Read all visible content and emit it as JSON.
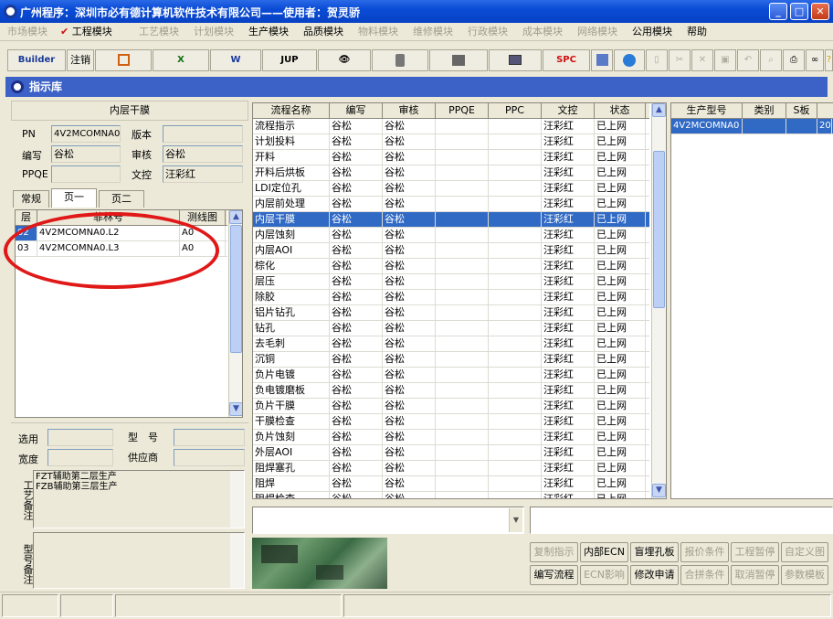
{
  "window": {
    "title": "广州程序：深圳市必有德计算机软件技术有限公司——使用者：贺灵骄",
    "min": "_",
    "max": "□",
    "close": "✕"
  },
  "menu": [
    {
      "label": "市场模块",
      "enabled": false
    },
    {
      "label": "工程模块",
      "enabled": true,
      "checked": true
    },
    {
      "label": "工艺模块",
      "enabled": false
    },
    {
      "label": "计划模块",
      "enabled": false
    },
    {
      "label": "生产模块",
      "enabled": true
    },
    {
      "label": "品质模块",
      "enabled": true
    },
    {
      "label": "物料模块",
      "enabled": false
    },
    {
      "label": "维修模块",
      "enabled": false
    },
    {
      "label": "行政模块",
      "enabled": false
    },
    {
      "label": "成本模块",
      "enabled": false
    },
    {
      "label": "网络模块",
      "enabled": false
    },
    {
      "label": "公用模块",
      "enabled": true
    },
    {
      "label": "帮助",
      "enabled": true
    }
  ],
  "toolbar": {
    "builder": "Builder",
    "logout": "注销",
    "jup": "JUP",
    "spc": "SPC",
    "word_icon": "W",
    "excel_icon": "X"
  },
  "doc": {
    "title": "指示库"
  },
  "left": {
    "header": "内层干膜",
    "pn_label": "PN",
    "pn_value": "4V2MCOMNA0",
    "version_label": "版本",
    "version_value": "",
    "author_label": "编写",
    "author_value": "谷松",
    "review_label": "审核",
    "review_value": "谷松",
    "ppqe_label": "PPQE",
    "ppqe_value": "",
    "doc_label": "文控",
    "doc_value": "汪彩红",
    "tabs": [
      "常规",
      "页一",
      "页二"
    ],
    "layer_headers": [
      "层",
      "菲林号",
      "测线图"
    ],
    "layers": [
      {
        "layer": "02",
        "film": "4V2MCOMNA0.L2",
        "chart": "A0"
      },
      {
        "layer": "03",
        "film": "4V2MCOMNA0.L3",
        "chart": "A0"
      }
    ],
    "select_label": "选用",
    "model_label": "型　号",
    "width_label": "宽度",
    "supplier_label": "供应商",
    "process_note_label": "工艺备注",
    "process_note": "FZT辅助第二层生产\nFZB辅助第三层生产",
    "model_note_label": "型号备注"
  },
  "flow": {
    "headers": [
      "流程名称",
      "编写",
      "审核",
      "PPQE",
      "PPC",
      "文控",
      "状态"
    ],
    "selected_index": 6,
    "rows": [
      [
        "流程指示",
        "谷松",
        "谷松",
        "",
        "",
        "汪彩红",
        "已上网"
      ],
      [
        "计划投料",
        "谷松",
        "谷松",
        "",
        "",
        "汪彩红",
        "已上网"
      ],
      [
        "开料",
        "谷松",
        "谷松",
        "",
        "",
        "汪彩红",
        "已上网"
      ],
      [
        "开料后烘板",
        "谷松",
        "谷松",
        "",
        "",
        "汪彩红",
        "已上网"
      ],
      [
        "LDI定位孔",
        "谷松",
        "谷松",
        "",
        "",
        "汪彩红",
        "已上网"
      ],
      [
        "内层前处理",
        "谷松",
        "谷松",
        "",
        "",
        "汪彩红",
        "已上网"
      ],
      [
        "内层干膜",
        "谷松",
        "谷松",
        "",
        "",
        "汪彩红",
        "已上网"
      ],
      [
        "内层蚀刻",
        "谷松",
        "谷松",
        "",
        "",
        "汪彩红",
        "已上网"
      ],
      [
        "内层AOI",
        "谷松",
        "谷松",
        "",
        "",
        "汪彩红",
        "已上网"
      ],
      [
        "棕化",
        "谷松",
        "谷松",
        "",
        "",
        "汪彩红",
        "已上网"
      ],
      [
        "层压",
        "谷松",
        "谷松",
        "",
        "",
        "汪彩红",
        "已上网"
      ],
      [
        "除胶",
        "谷松",
        "谷松",
        "",
        "",
        "汪彩红",
        "已上网"
      ],
      [
        "铝片钻孔",
        "谷松",
        "谷松",
        "",
        "",
        "汪彩红",
        "已上网"
      ],
      [
        "钻孔",
        "谷松",
        "谷松",
        "",
        "",
        "汪彩红",
        "已上网"
      ],
      [
        "去毛刺",
        "谷松",
        "谷松",
        "",
        "",
        "汪彩红",
        "已上网"
      ],
      [
        "沉铜",
        "谷松",
        "谷松",
        "",
        "",
        "汪彩红",
        "已上网"
      ],
      [
        "负片电镀",
        "谷松",
        "谷松",
        "",
        "",
        "汪彩红",
        "已上网"
      ],
      [
        "负电镀磨板",
        "谷松",
        "谷松",
        "",
        "",
        "汪彩红",
        "已上网"
      ],
      [
        "负片干膜",
        "谷松",
        "谷松",
        "",
        "",
        "汪彩红",
        "已上网"
      ],
      [
        "干膜检查",
        "谷松",
        "谷松",
        "",
        "",
        "汪彩红",
        "已上网"
      ],
      [
        "负片蚀刻",
        "谷松",
        "谷松",
        "",
        "",
        "汪彩红",
        "已上网"
      ],
      [
        "外层AOI",
        "谷松",
        "谷松",
        "",
        "",
        "汪彩红",
        "已上网"
      ],
      [
        "阻焊塞孔",
        "谷松",
        "谷松",
        "",
        "",
        "汪彩红",
        "已上网"
      ],
      [
        "阻焊",
        "谷松",
        "谷松",
        "",
        "",
        "汪彩红",
        "已上网"
      ],
      [
        "阻焊检查",
        "谷松",
        "谷松",
        "",
        "",
        "汪彩红",
        "已上网"
      ]
    ]
  },
  "right": {
    "headers": [
      "生产型号",
      "类别",
      "S板"
    ],
    "rows": [
      [
        "4V2MCOMNA0",
        "",
        "",
        "20"
      ]
    ]
  },
  "buttons": [
    {
      "label": "复制指示",
      "enabled": false
    },
    {
      "label": "内部ECN",
      "enabled": true
    },
    {
      "label": "盲埋孔板",
      "enabled": true
    },
    {
      "label": "报价条件",
      "enabled": false
    },
    {
      "label": "工程暂停",
      "enabled": false
    },
    {
      "label": "自定义图",
      "enabled": false
    },
    {
      "label": "编写流程",
      "enabled": true
    },
    {
      "label": "ECN影响",
      "enabled": false
    },
    {
      "label": "修改申请",
      "enabled": true
    },
    {
      "label": "合拼条件",
      "enabled": false
    },
    {
      "label": "取消暂停",
      "enabled": false
    },
    {
      "label": "参数模板",
      "enabled": false
    }
  ],
  "colors": {
    "title_bar": "#0a4bd6",
    "doc_bar": "#3c62c8",
    "selection": "#316ac5",
    "annotation": "#e01818",
    "disabled_text": "#a09d8e"
  }
}
